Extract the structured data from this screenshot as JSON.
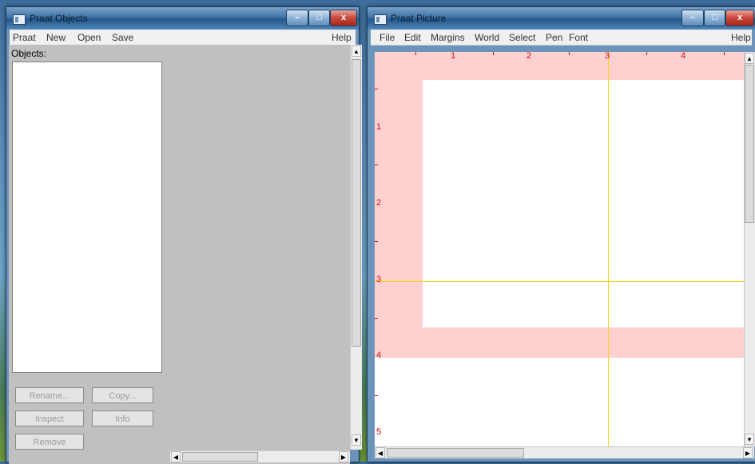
{
  "objects_window": {
    "title": "Praat Objects",
    "menu": [
      "Praat",
      "New",
      "Open",
      "Save"
    ],
    "help": "Help",
    "objects_label": "Objects:",
    "buttons": {
      "rename": "Rename...",
      "copy": "Copy...",
      "inspect": "Inspect",
      "info": "Info",
      "remove": "Remove"
    }
  },
  "picture_window": {
    "title": "Praat Picture",
    "menu": [
      "File",
      "Edit",
      "Margins",
      "World",
      "Select",
      "Pen",
      "Font"
    ],
    "help": "Help",
    "ruler_top": [
      "1",
      "2",
      "3",
      "4"
    ],
    "ruler_left": [
      "1",
      "2",
      "3",
      "4",
      "5"
    ]
  },
  "window_controls": {
    "minimize": "–",
    "maximize": "□",
    "close": "x"
  },
  "colors": {
    "selection": "#ffd0d0",
    "guide": "#f2d51a",
    "ruler": "#d01010"
  }
}
